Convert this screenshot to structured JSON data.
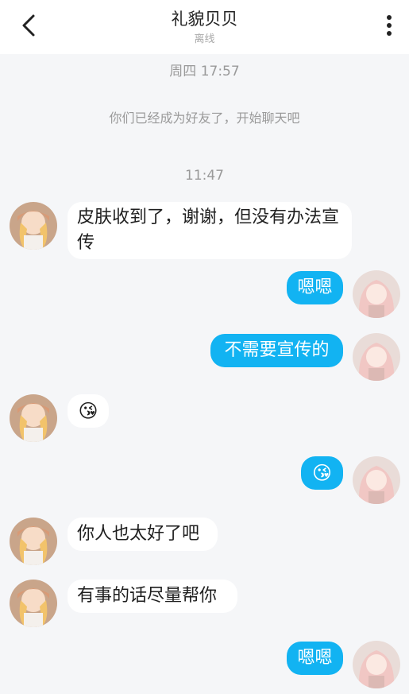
{
  "header": {
    "title": "礼貌贝贝",
    "subtitle": "离线"
  },
  "system": {
    "time1": "周四 17:57",
    "notice": "你们已经成为好友了，开始聊天吧",
    "time2": "11:47"
  },
  "messages": [
    {
      "side": "in",
      "text": "皮肤收到了，谢谢，但没有办法宣传"
    },
    {
      "side": "out",
      "text": "嗯嗯"
    },
    {
      "side": "out",
      "text": "不需要宣传的"
    },
    {
      "side": "in",
      "text": "😘"
    },
    {
      "side": "out",
      "text": "😘"
    },
    {
      "side": "in",
      "text": "你人也太好了吧"
    },
    {
      "side": "in",
      "text": "有事的话尽量帮你"
    },
    {
      "side": "out",
      "text": "嗯嗯"
    }
  ],
  "icons": {
    "back": "chevron-left-icon",
    "more": "vertical-dots-icon"
  },
  "colors": {
    "outgoing_bubble": "#12b3f2",
    "incoming_bubble": "#ffffff",
    "background": "#f5f6f8"
  }
}
